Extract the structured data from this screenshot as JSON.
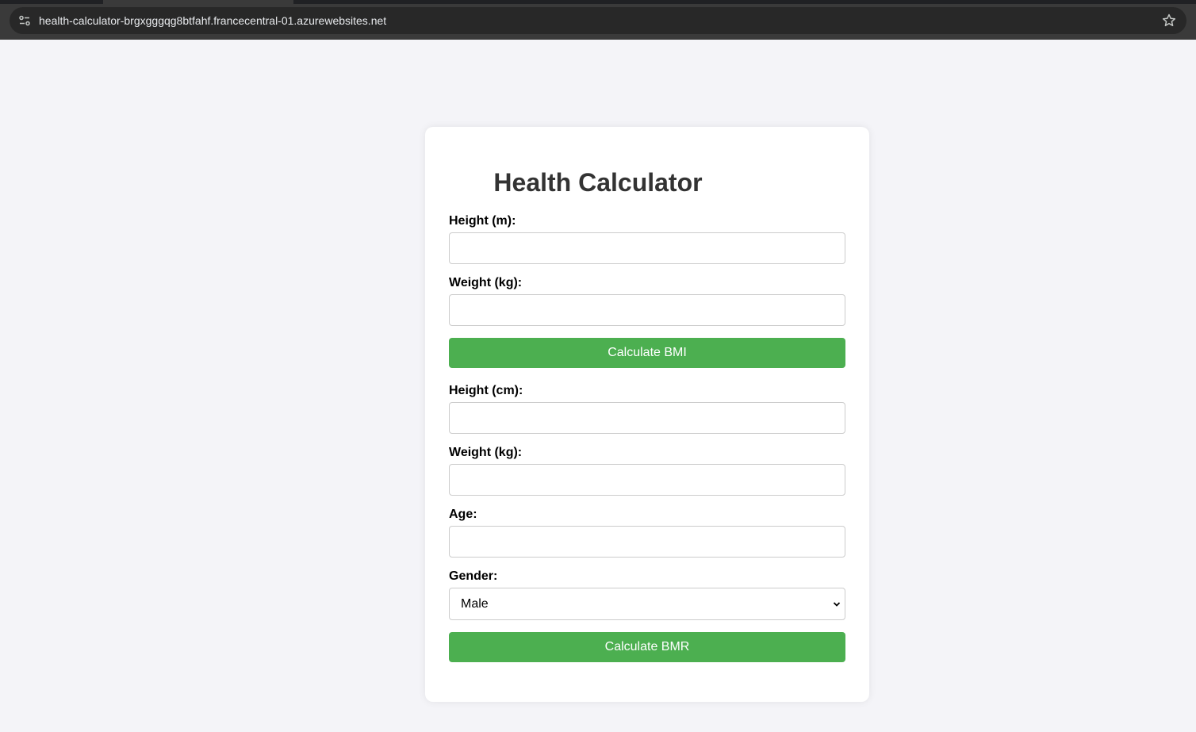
{
  "browser": {
    "url": "health-calculator-brgxgggqg8btfahf.francecentral-01.azurewebsites.net",
    "site_info_icon": "tune-icon",
    "bookmark_icon": "star-icon"
  },
  "page": {
    "title": "Health Calculator"
  },
  "bmi_form": {
    "height_label": "Height (m):",
    "height_value": "",
    "weight_label": "Weight (kg):",
    "weight_value": "",
    "button_label": "Calculate BMI"
  },
  "bmr_form": {
    "height_label": "Height (cm):",
    "height_value": "",
    "weight_label": "Weight (kg):",
    "weight_value": "",
    "age_label": "Age:",
    "age_value": "",
    "gender_label": "Gender:",
    "gender_selected": "Male",
    "button_label": "Calculate BMR"
  },
  "colors": {
    "accent": "#4caf50",
    "background": "#f4f4f8",
    "card": "#ffffff",
    "title": "#333333"
  }
}
